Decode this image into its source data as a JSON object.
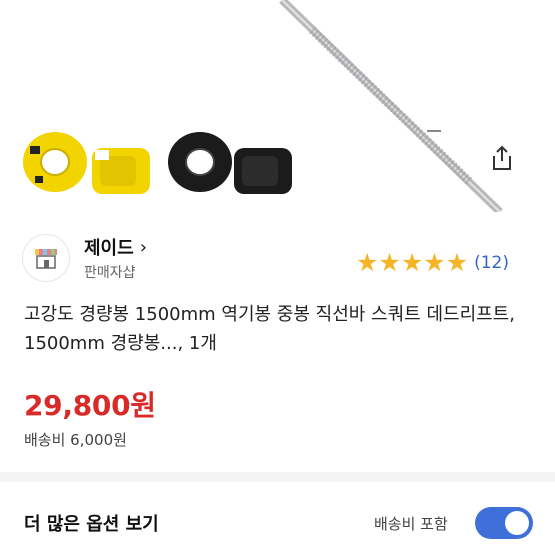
{
  "seller": {
    "name": "제이드",
    "chevron": "›",
    "subtitle": "판매자샵",
    "avatar_icon": "shop-icon"
  },
  "rating": {
    "stars": 5,
    "count_label": "(12)"
  },
  "product": {
    "title": "고강도 경량봉 1500mm 역기봉 중봉 직선바 스쿼트 데드리프트, 1500mm 경량봉..., 1개",
    "price": "29,800원",
    "shipping": "배송비 6,000원"
  },
  "options": {
    "title": "더 많은 옵션 보기",
    "toggle_label": "배송비 포함",
    "toggle_on": true
  },
  "colors": {
    "price": "#d92a2a",
    "star": "#f5b526",
    "link": "#3264c8",
    "toggle": "#3f6fd8",
    "collar_yellow": "#f2d400"
  },
  "icons": {
    "share": "share-icon"
  }
}
